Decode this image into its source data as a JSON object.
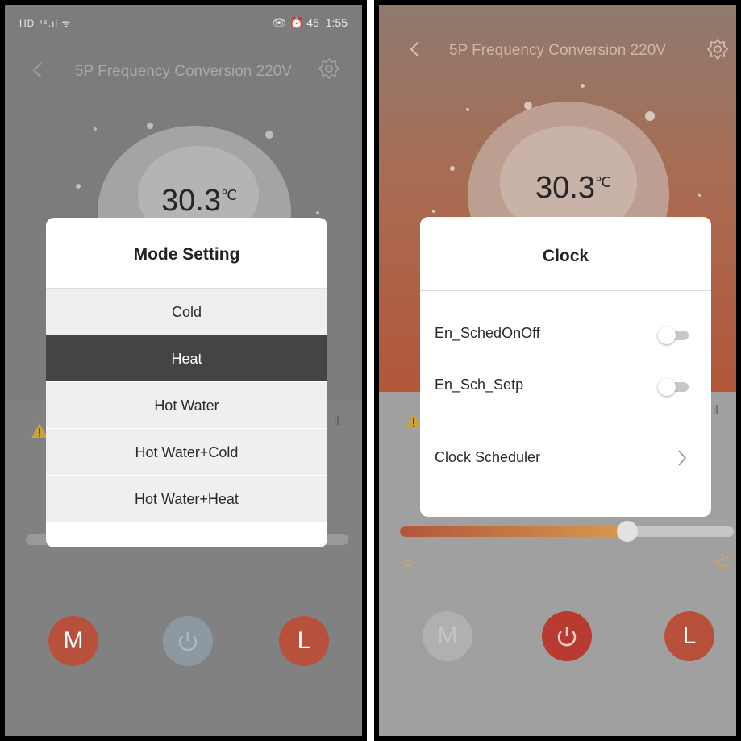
{
  "left_screen": {
    "status_bar": {
      "icons_left": "HD ⁴⁶.ıl ᯤ",
      "icons_right": "👁 ⏰ 45",
      "time": "1:55"
    },
    "header": {
      "title": "5P Frequency Conversion 220V",
      "back_icon": "chevron-left-icon",
      "settings_icon": "gear-icon"
    },
    "temperature": {
      "value": "30.3",
      "unit": "℃"
    },
    "status_text_partial": "il",
    "mode_dialog": {
      "title": "Mode Setting",
      "options": [
        {
          "label": "Cold",
          "selected": false
        },
        {
          "label": "Heat",
          "selected": true
        },
        {
          "label": "Hot Water",
          "selected": false
        },
        {
          "label": "Hot Water+Cold",
          "selected": false
        },
        {
          "label": "Hot Water+Heat",
          "selected": false
        }
      ]
    },
    "buttons": {
      "mode_label": "M",
      "clock_label": "L",
      "power_icon": "power-icon"
    }
  },
  "right_screen": {
    "header": {
      "title": "5P Frequency Conversion 220V",
      "back_icon": "chevron-left-icon",
      "settings_icon": "gear-icon"
    },
    "temperature": {
      "value": "30.3",
      "unit": "℃"
    },
    "status_text_partial": "il",
    "clock_dialog": {
      "title": "Clock",
      "toggles": [
        {
          "label": "En_SchedOnOff",
          "on": false
        },
        {
          "label": "En_Sch_Setp",
          "on": false
        }
      ],
      "scheduler_label": "Clock Scheduler"
    },
    "slider": {
      "level": 0.68,
      "min_icon": "sun-small-icon",
      "max_icon": "sun-large-icon"
    },
    "buttons": {
      "mode_label": "M",
      "clock_label": "L",
      "power_icon": "power-icon"
    }
  },
  "colors": {
    "accent_orange": "#e0603f",
    "selected_item_bg": "#444444",
    "power_button_active": "#c94a3a",
    "power_button_inactive": "#9fb0bf"
  }
}
